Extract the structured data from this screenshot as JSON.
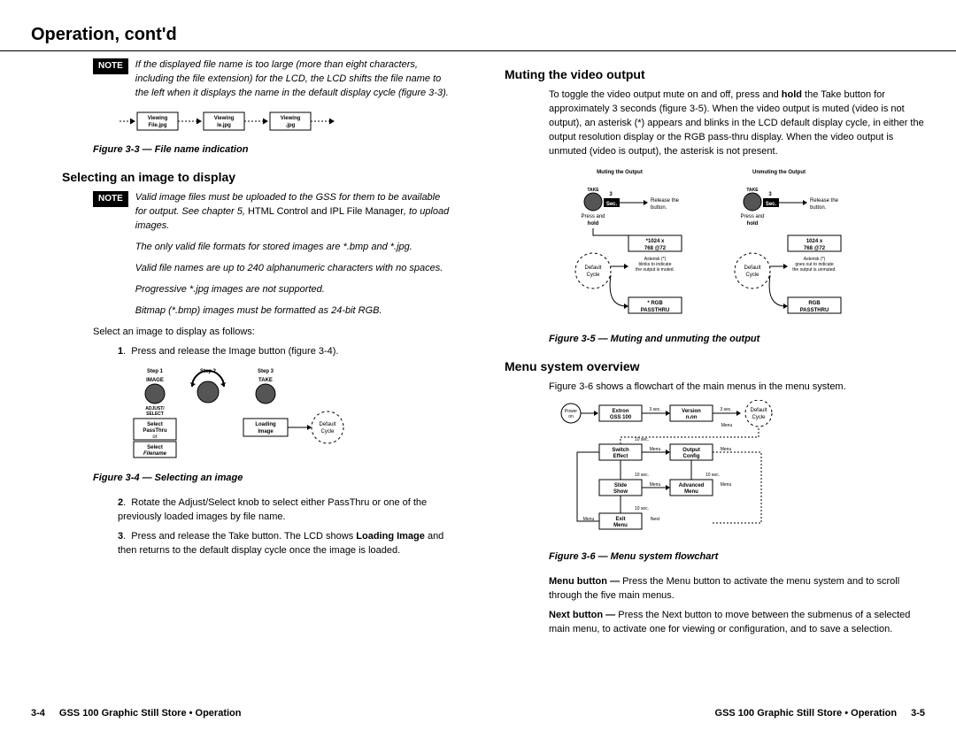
{
  "header": {
    "title": "Operation, cont'd"
  },
  "left": {
    "note1": "If the displayed file name is too large (more than eight characters, including the file extension) for the LCD, the LCD shifts the file name to the left when it displays the name in the default display cycle (figure 3-3).",
    "fig3_viewing1": "Viewing",
    "fig3_file1": "File.jpg",
    "fig3_viewing2": "Viewing",
    "fig3_file2": "le.jpg",
    "fig3_viewing3": "Viewing",
    "fig3_file3": ".jpg",
    "fig3_caption": "Figure 3-3 — File name indication",
    "h_select": "Selecting an image to display",
    "note2_a": "Valid image files must be uploaded to the GSS for them to be available for output.  See chapter 5, ",
    "note2_b": "HTML Control and IPL File Manager",
    "note2_c": ", to upload images.",
    "note2_p2": "The only valid file formats for stored images are *.bmp and *.jpg.",
    "note2_p3": "Valid file names are up to 240 alphanumeric characters with no spaces.",
    "note2_p4": "Progressive *.jpg images are not supported.",
    "note2_p5": "Bitmap (*.bmp) images must be formatted as 24-bit RGB.",
    "select_intro": "Select an image to display as follows:",
    "step1": "Press and release the Image button (figure 3-4).",
    "fig4_step1": "Step 1",
    "fig4_step2": "Step 2",
    "fig4_step3": "Step 3",
    "fig4_image": "IMAGE",
    "fig4_adjust": "ADJUST/\nSELECT",
    "fig4_take": "TAKE",
    "fig4_selpass_a": "Select",
    "fig4_selpass_b": "PassThru",
    "fig4_selpass_c": "or",
    "fig4_selfile_a": "Select",
    "fig4_selfile_b": "Filename",
    "fig4_loading_a": "Loading",
    "fig4_loading_b": "Image",
    "fig4_default": "Default\nCycle",
    "fig4_caption": "Figure 3-4 — Selecting an image",
    "step2": "Rotate the Adjust/Select knob to select either PassThru or one of the previously loaded images by file name.",
    "step3_a": "Press and release the Take button.  The LCD shows ",
    "step3_b": "Loading Image",
    "step3_c": " and then returns to the default display cycle once the image is loaded."
  },
  "right": {
    "h_mute": "Muting the video output",
    "mute_para_a": "To toggle the video output mute on and off, press and ",
    "mute_hold": "hold",
    "mute_para_b": " the Take button for approximately 3 seconds (figure 3-5).  When the video output is muted (video is not output), an asterisk (*) appears and blinks in the LCD default display cycle, in either the output resolution display or the RGB pass-thru display.  When the video output is unmuted (video is output), the asterisk is not present.",
    "fig5_mute_title": "Muting the Output",
    "fig5_unmute_title": "Unmuting the Output",
    "fig5_take": "TAKE",
    "fig5_3": "3",
    "fig5_sec": "Sec.",
    "fig5_release": "Release the button.",
    "fig5_press": "Press and",
    "fig5_holdw": "hold",
    "fig5_res_m": "*1024 x 768  @72",
    "fig5_res_u": "1024 x 768  @72",
    "fig5_ast_m": "Asterisk (*) blinks to indicate the output is muted.",
    "fig5_ast_u": "Asterisk (*) goes out to indicate the output is unmuted.",
    "fig5_rgb_m": "* RGB PASSTHRU",
    "fig5_rgb_u": "RGB PASSTHRU",
    "fig5_default": "Default Cycle",
    "fig5_caption": "Figure 3-5 — Muting and unmuting the output",
    "h_menu": "Menu system overview",
    "menu_para": "Figure 3-6 shows a flowchart of the main menus in the menu system.",
    "fig6_power": "Power on",
    "fig6_extron": "Extron GSS  100",
    "fig6_3sec": "3 sec.",
    "fig6_version_a": "Version",
    "fig6_version_b": "n.nn",
    "fig6_default": "Default Cycle",
    "fig6_switch": "Switch Effect",
    "fig6_output": "Output Config",
    "fig6_slide": "Slide Show",
    "fig6_advanced": "Advanced Menu",
    "fig6_exit": "Exit Menu",
    "fig6_menu": "Menu",
    "fig6_next": "Next",
    "fig6_10sec": "10 sec.",
    "fig6_caption": "Figure 3-6 — Menu system flowchart",
    "menu_btn_label": "Menu button —",
    "menu_btn_text": " Press the Menu button to activate the menu system and to scroll through the five main menus.",
    "next_btn_label": "Next button —",
    "next_btn_text": " Press the Next button to move between the submenus of a selected main menu, to activate one for viewing or configuration, and to save a selection."
  },
  "footer": {
    "left_num": "3-4",
    "left_text": "GSS 100 Graphic Still Store • Operation",
    "right_text": "GSS 100 Graphic Still Store • Operation",
    "right_num": "3-5"
  }
}
